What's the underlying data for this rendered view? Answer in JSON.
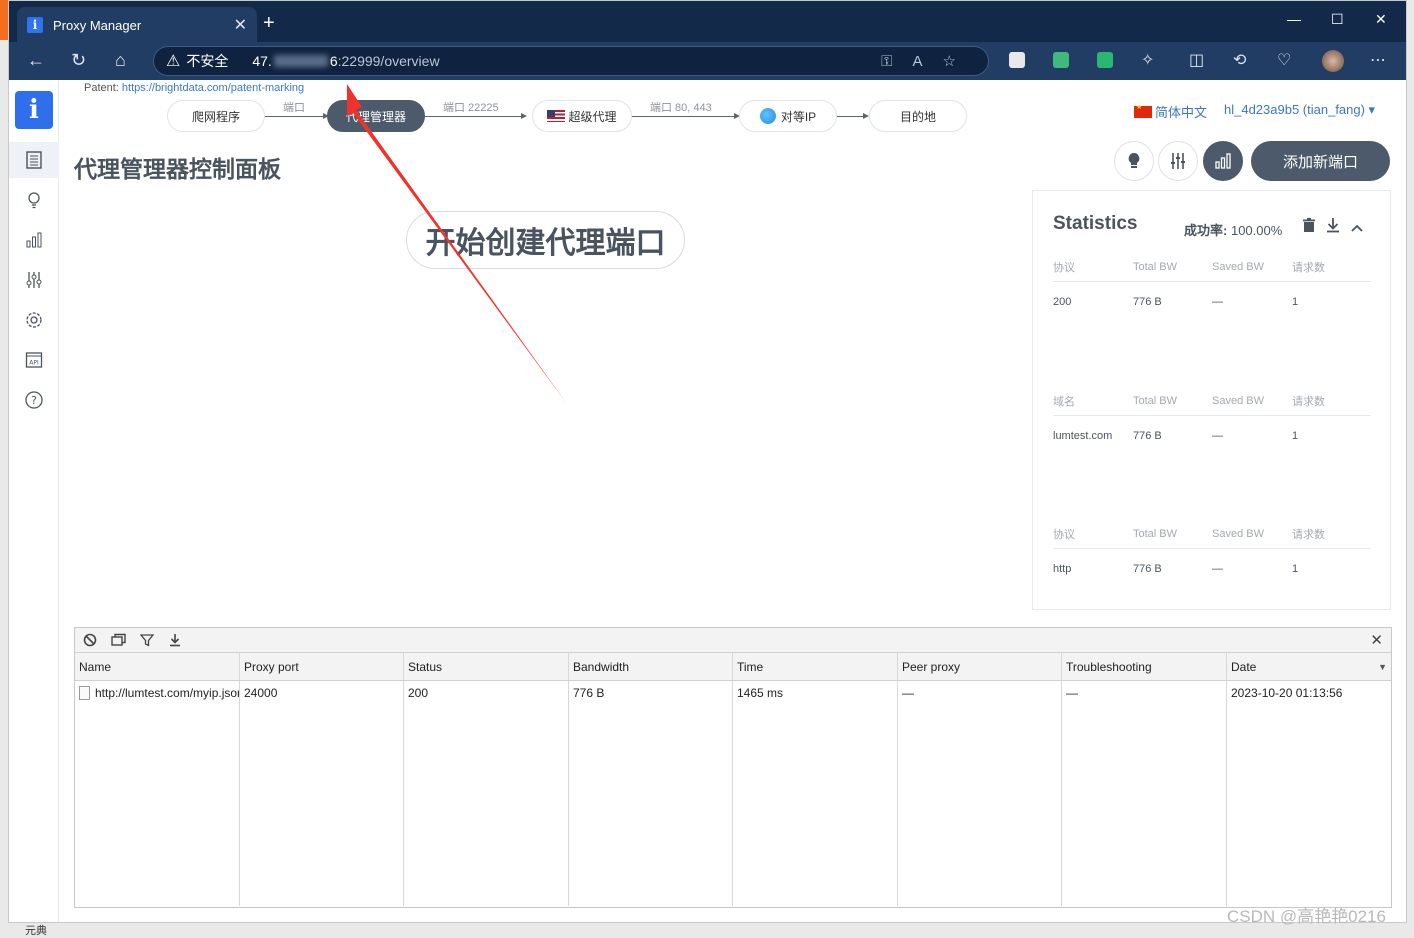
{
  "browser": {
    "tab_title": "Proxy Manager",
    "tab_close": "✕",
    "new_tab": "+",
    "insecure_label": "不安全",
    "url_host_start": "47.",
    "url_host_end": "6",
    "url_rest": ":22999/overview",
    "window_controls": [
      "—",
      "☐",
      "✕"
    ]
  },
  "header": {
    "patent_label": "Patent:",
    "patent_link": "https://brightdata.com/patent-marking",
    "flow": {
      "nodes": [
        "爬网程序",
        "代理管理器",
        "超级代理",
        "对等IP",
        "目的地"
      ],
      "links": [
        "端口",
        "端口 22225",
        "端口 80, 443"
      ]
    },
    "language": "简体中文",
    "user": "hl_4d23a9b5 (tian_fang) ▾"
  },
  "main": {
    "title": "代理管理器控制面板",
    "add_port_label": "添加新端口",
    "start_label": "开始创建代理端口"
  },
  "stats": {
    "title": "Statistics",
    "success_label": "成功率:",
    "success_value": "100.00%",
    "tables": [
      {
        "headers": [
          "协议",
          "Total BW",
          "Saved BW",
          "请求数"
        ],
        "rows": [
          [
            "200",
            "776 B",
            "—",
            "1"
          ]
        ]
      },
      {
        "headers": [
          "域名",
          "Total BW",
          "Saved BW",
          "请求数"
        ],
        "rows": [
          [
            "lumtest.com",
            "776 B",
            "—",
            "1"
          ]
        ]
      },
      {
        "headers": [
          "协议",
          "Total BW",
          "Saved BW",
          "请求数"
        ],
        "rows": [
          [
            "http",
            "776 B",
            "—",
            "1"
          ]
        ]
      }
    ]
  },
  "log": {
    "columns": [
      "Name",
      "Proxy port",
      "Status",
      "Bandwidth",
      "Time",
      "Peer proxy",
      "Troubleshooting",
      "Date"
    ],
    "rows": [
      [
        "http://lumtest.com/myip.json",
        "24000",
        "200",
        "776 B",
        "1465 ms",
        "—",
        "—",
        "2023-10-20 01:13:56"
      ]
    ]
  },
  "watermark": "CSDN @高艳艳0216",
  "below_text": "元典"
}
